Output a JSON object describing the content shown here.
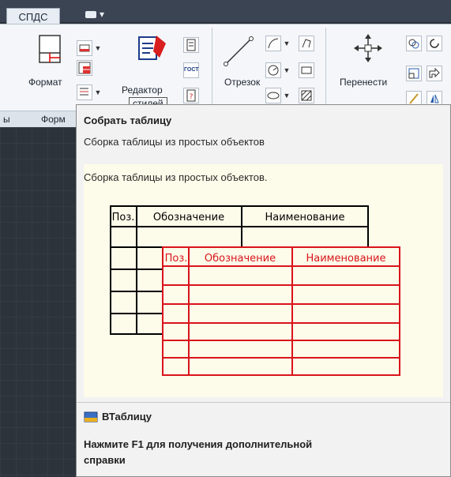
{
  "tabs": {
    "active": "СПДС",
    "switch_glyph": "▾"
  },
  "ribbon": {
    "format_label": "Формат",
    "editor_label_1": "Редактор",
    "editor_label_2": "стилей",
    "segment_label": "Отрезок",
    "move_label": "Перенести",
    "gost_label": "ГОСТ"
  },
  "panels": {
    "left_caption": "ы",
    "format_caption": "Форм"
  },
  "tooltip": {
    "title": "Собрать таблицу",
    "description": "Сборка таблицы из простых объектов",
    "extended": "Сборка таблицы из простых объектов.",
    "command": "ВТаблицу",
    "help": "Нажмите F1 для получения дополнительной справки"
  },
  "illustration": {
    "black_table": {
      "col1": "Поз.",
      "col2": "Обозначение",
      "col3": "Наименование"
    },
    "red_table": {
      "col1": "Поз.",
      "col2": "Обозначение",
      "col3": "Наименование"
    }
  },
  "colors": {
    "ribbon_bg": "#f4f6f9",
    "tooltip_bg": "#f2f2f2",
    "illustration_bg": "#fdfbe9",
    "red_table": "#d9141b",
    "black_table": "#000000"
  }
}
